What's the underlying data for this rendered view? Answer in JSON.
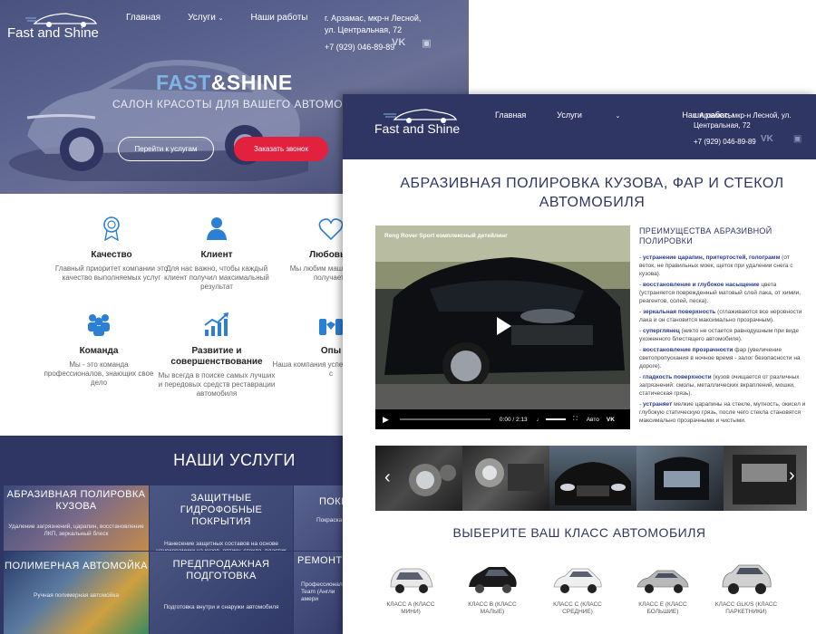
{
  "brand": {
    "name": "Fast and Shine"
  },
  "nav": {
    "home": "Главная",
    "services": "Услуги",
    "works": "Наши работы"
  },
  "contact": {
    "address": "г. Арзамас, мкр-н Лесной, ул. Центральная, 72",
    "phone": "+7 (929) 046-89-89"
  },
  "hero": {
    "title_part1": "FAST",
    "title_part2": "&SHINE",
    "subtitle": "САЛОН КРАСОТЫ ДЛЯ ВАШЕГО АВТОМОБИЛЯ",
    "btn_services": "Перейти к услугам",
    "btn_call": "Заказать звонок"
  },
  "features": [
    {
      "title": "Качество",
      "desc": "Главный приоритет компании это качество выполняемых услуг"
    },
    {
      "title": "Клиент",
      "desc": "Для нас важно, чтобы каждый клиент получил максимальный результат"
    },
    {
      "title": "Любовь к",
      "desc": "Мы любим машины их и получаете"
    },
    {
      "title": "Команда",
      "desc": "Мы - это команда профессионалов, знающих свое дело"
    },
    {
      "title": "Развитие и совершенствование",
      "desc": "Мы всегда в поиске самых лучших и передовых средств реставрации автомобиля"
    },
    {
      "title": "Опы",
      "desc": "Наша компания успешно работает с"
    }
  ],
  "services": {
    "title": "НАШИ УСЛУГИ",
    "tiles": [
      {
        "title": "АБРАЗИВНАЯ ПОЛИРОВКА КУЗОВА",
        "desc": "Удаление загрязнений, царапин, восстановление ЛКП, зеркальный блеск"
      },
      {
        "title": "ЗАЩИТНЫЕ ГИДРОФОБНЫЕ ПОКРЫТИЯ",
        "desc": "Нанесение защитных составов на основе нанокерамики на кузов, оптику, стекла, пластик"
      },
      {
        "title": "ПОКР",
        "desc": "Покраска д"
      },
      {
        "title": "ПОЛИМЕРНАЯ АВТОМОЙКА",
        "desc": "Ручная полимерная автомойка"
      },
      {
        "title": "ПРЕДПРОДАЖНАЯ ПОДГОТОВКА",
        "desc": "Подготовка внутри и снаружи автомобиля"
      },
      {
        "title": "РЕМОНТ Д",
        "desc": "Профессиональ Team (Англи амери"
      }
    ]
  },
  "page": {
    "title": "АБРАЗИВНАЯ ПОЛИРОВКА КУЗОВА, ФАР И СТЕКОЛ АВТОМОБИЛЯ"
  },
  "video": {
    "title": "Reng Rover Sport комплексный детейлинг",
    "time": "0:00 / 2:13",
    "lang": "Авто"
  },
  "advantages": {
    "title": "ПРЕИМУЩЕСТВА АБРАЗИВНОЙ ПОЛИРОВКИ",
    "items": [
      {
        "hl": "устранение царапин, притертостей, голограмм",
        "text": " (от веток, не правильных моек, щеток при удалении снега с кузова)."
      },
      {
        "hl": "восстановление и глубокое насыщение",
        "text": " цвета (устраняется поврежденный матовый слой лака, от химии, реагентов, солей, песка)."
      },
      {
        "hl": "зеркальная поверхность",
        "text": " (сглаживаются все неровности лака и он становится максимально прозрачным)."
      },
      {
        "hl": "суперглянец",
        "text": " (никто не остается равнодушным при виде ухоженного блестящего автомобиля)."
      },
      {
        "hl": "восстановление прозрачности",
        "text": " фар (увеличение светопропускания в ночное время - залог безопасности на дороге)."
      },
      {
        "hl": "гладкость поверхности",
        "text": " (кузов очищается от различных загрязнений: смолы, металлических вкраплений, мошки, статическая грязь)."
      },
      {
        "hl": "устраняет",
        "text": " мелкие царапины на стекле, мутность, окисел и глубокую статическую грязь, после чего стекла становятся максимально прозрачными и чистыми."
      }
    ]
  },
  "classes": {
    "title": "ВЫБЕРИТЕ ВАШ КЛАСС АВТОМОБИЛЯ",
    "items": [
      {
        "label": "КЛАСС A (КЛАСС МИНИ)",
        "color": "#e8e8e8"
      },
      {
        "label": "КЛАСС B (КЛАСС МАЛЫЕ)",
        "color": "#1a1a1a"
      },
      {
        "label": "КЛАСС C (КЛАСС СРЕДНИЕ)",
        "color": "#f0f0f0"
      },
      {
        "label": "КЛАСС E (КЛАСС БОЛЬШИЕ)",
        "color": "#b8b8b8"
      },
      {
        "label": "КЛАСС GLK/S (КЛАСС ПАРКЕТНИКИ)",
        "color": "#d0d0d0"
      }
    ]
  },
  "colors": {
    "navy": "#2f3664",
    "red": "#e2213f",
    "icon_blue": "#2b7fd4"
  }
}
